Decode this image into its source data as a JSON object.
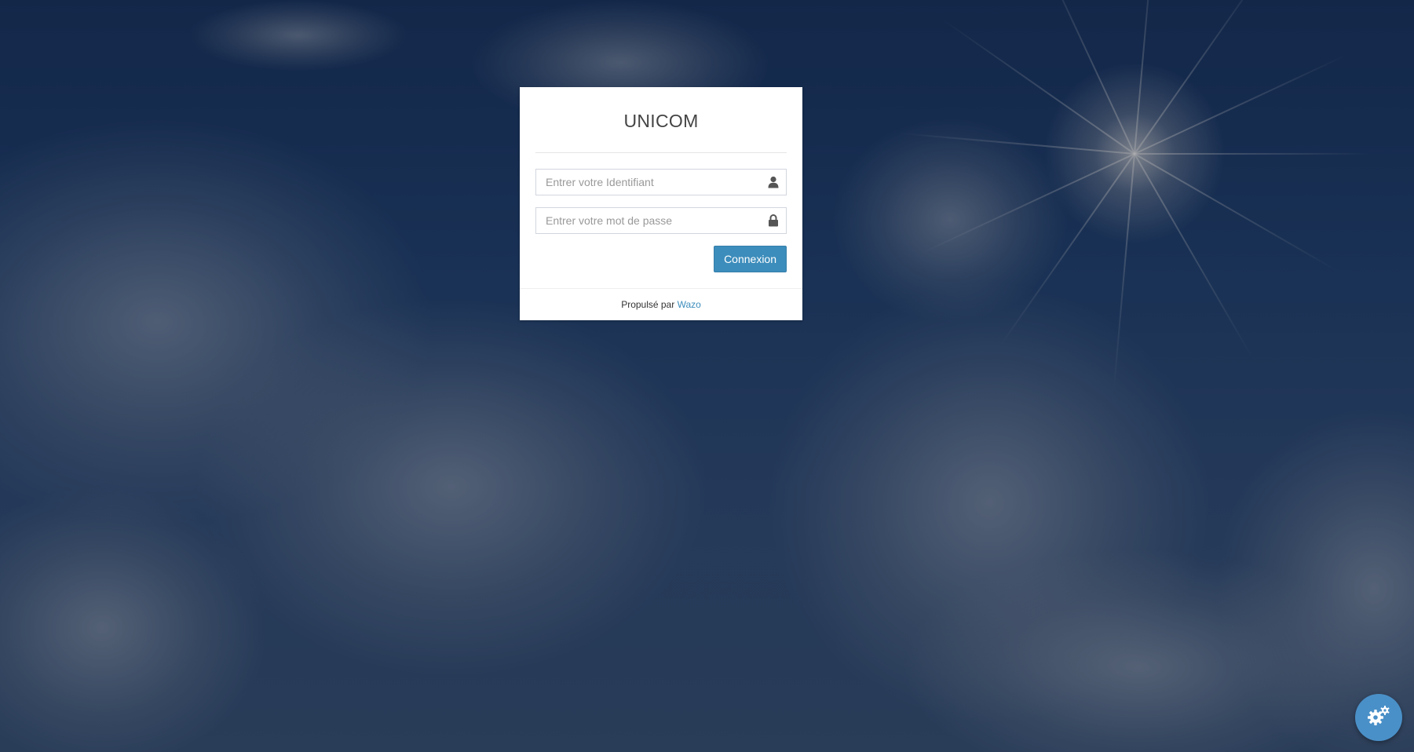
{
  "app": {
    "title": "UNICOM"
  },
  "login": {
    "username_placeholder": "Entrer votre Identifiant",
    "password_placeholder": "Entrer votre mot de passe",
    "submit_label": "Connexion",
    "username_icon": "user-icon",
    "password_icon": "lock-icon"
  },
  "footer": {
    "powered_by": "Propulsé par",
    "brand_link": "Wazo"
  },
  "settings_button": {
    "icon": "gears-icon"
  },
  "colors": {
    "accent": "#3c8dbc",
    "fab": "#4a90c8"
  }
}
